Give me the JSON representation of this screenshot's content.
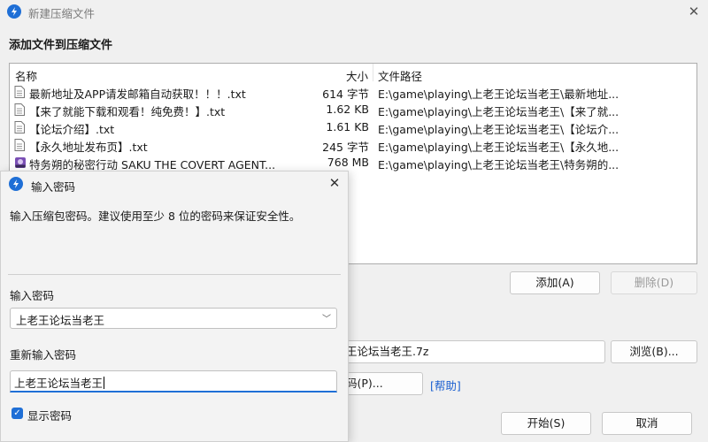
{
  "window": {
    "title": "新建压缩文件"
  },
  "section_title": "添加文件到压缩文件",
  "filelist": {
    "headers": {
      "name": "名称",
      "size": "大小",
      "path": "文件路径"
    },
    "rows": [
      {
        "name": "最新地址及APP请发邮箱自动获取！！！.txt",
        "size": "614 字节",
        "path": "E:\\game\\playing\\上老王论坛当老王\\最新地址...",
        "icon": "text-file-icon"
      },
      {
        "name": "【来了就能下载和观看！纯免费！】.txt",
        "size": "1.62 KB",
        "path": "E:\\game\\playing\\上老王论坛当老王\\【来了就...",
        "icon": "text-file-icon"
      },
      {
        "name": "【论坛介绍】.txt",
        "size": "1.61 KB",
        "path": "E:\\game\\playing\\上老王论坛当老王\\【论坛介...",
        "icon": "text-file-icon"
      },
      {
        "name": "【永久地址发布页】.txt",
        "size": "245 字节",
        "path": "E:\\game\\playing\\上老王论坛当老王\\【永久地...",
        "icon": "text-file-icon"
      },
      {
        "name": "特务朔的秘密行动 SAKU THE COVERT AGENT...",
        "size": "768 MB",
        "path": "E:\\game\\playing\\上老王论坛当老王\\特务朔的...",
        "icon": "rar-archive-icon"
      }
    ]
  },
  "buttons": {
    "add": "添加(A)",
    "delete": "删除(D)",
    "browse": "浏览(B)...",
    "password_partial": "码(P)...",
    "help": "[帮助]",
    "start": "开始(S)",
    "cancel": "取消"
  },
  "archive_path_partial": "王论坛当老王.7z",
  "dialog": {
    "title": "输入密码",
    "description": "输入压缩包密码。建议使用至少 8 位的密码来保证安全性。",
    "password_label": "输入密码",
    "password_value": "上老王论坛当老王",
    "reenter_label": "重新输入密码",
    "reenter_value": "上老王论坛当老王",
    "show_password_label": "显示密码"
  },
  "colors": {
    "accent": "#1f6fd6",
    "link": "#1a5fd0"
  }
}
